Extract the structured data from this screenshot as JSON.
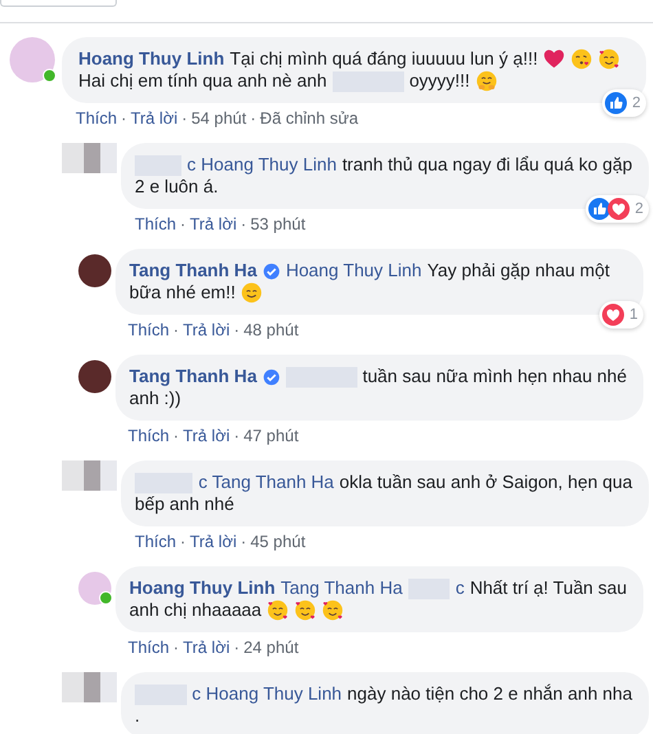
{
  "comments": [
    {
      "reply": false,
      "avatar": {
        "kind": "photo",
        "color": "#e6c8e8"
      },
      "online": true,
      "lines": [
        [
          {
            "kind": "author",
            "value": "Hoang Thuy Linh"
          },
          {
            "kind": "text",
            "value": "Tại chị mình quá đáng iuuuuu lun ý ạ!!!"
          },
          {
            "kind": "heart"
          },
          {
            "kind": "kiss"
          },
          {
            "kind": "love"
          }
        ],
        [
          {
            "kind": "text",
            "value": "Hai chị em tính qua anh nè anh"
          },
          {
            "kind": "redacted"
          },
          {
            "kind": "text",
            "value": "oyyyy!!!"
          },
          {
            "kind": "hug"
          }
        ]
      ],
      "reactions": {
        "icons": [
          {
            "kind": "like"
          }
        ],
        "count": "2"
      },
      "meta": [
        {
          "kind": "action",
          "value": "Thích"
        },
        {
          "kind": "separator",
          "value": "·"
        },
        {
          "kind": "action",
          "value": "Trả lời"
        },
        {
          "kind": "separator",
          "value": "·"
        },
        {
          "kind": "time",
          "value": "54 phút"
        },
        {
          "kind": "separator",
          "value": "·"
        },
        {
          "kind": "edited",
          "value": "Đã chỉnh sửa"
        }
      ]
    },
    {
      "reply": true,
      "avatar": {
        "kind": "blurred"
      },
      "lines": [
        [
          {
            "kind": "redacted"
          },
          {
            "kind": "mention",
            "value": "c Hoang Thuy Linh"
          },
          {
            "kind": "text",
            "value": "tranh thủ qua ngay đi lẩu quá ko gặp"
          }
        ],
        [
          {
            "kind": "text",
            "value": "2 e luôn á."
          }
        ]
      ],
      "reactions": {
        "icons": [
          {
            "kind": "like"
          },
          {
            "kind": "love"
          }
        ],
        "count": "2"
      },
      "meta": [
        {
          "kind": "action",
          "value": "Thích"
        },
        {
          "kind": "separator",
          "value": "·"
        },
        {
          "kind": "action",
          "value": "Trả lời"
        },
        {
          "kind": "separator",
          "value": "·"
        },
        {
          "kind": "time",
          "value": "53 phút"
        }
      ]
    },
    {
      "reply": true,
      "avatar": {
        "kind": "photo",
        "color": "#5a2a2a"
      },
      "verified": true,
      "lines": [
        [
          {
            "kind": "author",
            "value": "Tang Thanh Ha"
          },
          {
            "kind": "verified"
          },
          {
            "kind": "mention",
            "value": "Hoang Thuy Linh"
          },
          {
            "kind": "text",
            "value": "Yay phải gặp nhau một"
          }
        ],
        [
          {
            "kind": "text",
            "value": "bữa nhé em!!"
          },
          {
            "kind": "smile"
          }
        ]
      ],
      "reactions": {
        "icons": [
          {
            "kind": "love"
          }
        ],
        "count": "1"
      },
      "meta": [
        {
          "kind": "action",
          "value": "Thích"
        },
        {
          "kind": "separator",
          "value": "·"
        },
        {
          "kind": "action",
          "value": "Trả lời"
        },
        {
          "kind": "separator",
          "value": "·"
        },
        {
          "kind": "time",
          "value": "48 phút"
        }
      ]
    },
    {
      "reply": true,
      "avatar": {
        "kind": "photo",
        "color": "#5a2a2a"
      },
      "verified": true,
      "lines": [
        [
          {
            "kind": "author",
            "value": "Tang Thanh Ha"
          },
          {
            "kind": "verified"
          },
          {
            "kind": "redacted"
          },
          {
            "kind": "text",
            "value": "tuần sau nữa mình hẹn nhau nhé"
          }
        ],
        [
          {
            "kind": "text",
            "value": "anh :))"
          }
        ]
      ],
      "meta": [
        {
          "kind": "action",
          "value": "Thích"
        },
        {
          "kind": "separator",
          "value": "·"
        },
        {
          "kind": "action",
          "value": "Trả lời"
        },
        {
          "kind": "separator",
          "value": "·"
        },
        {
          "kind": "time",
          "value": "47 phút"
        }
      ]
    },
    {
      "reply": true,
      "avatar": {
        "kind": "blurred"
      },
      "lines": [
        [
          {
            "kind": "redacted"
          },
          {
            "kind": "mention",
            "value": "c Tang Thanh Ha"
          },
          {
            "kind": "text",
            "value": "okla tuần sau anh ở Saigon, hẹn qua"
          }
        ],
        [
          {
            "kind": "text",
            "value": "bếp anh nhé"
          }
        ]
      ],
      "meta": [
        {
          "kind": "action",
          "value": "Thích"
        },
        {
          "kind": "separator",
          "value": "·"
        },
        {
          "kind": "action",
          "value": "Trả lời"
        },
        {
          "kind": "separator",
          "value": "·"
        },
        {
          "kind": "time",
          "value": "45 phút"
        }
      ]
    },
    {
      "reply": true,
      "avatar": {
        "kind": "photo",
        "color": "#e6c8e8"
      },
      "online": true,
      "lines": [
        [
          {
            "kind": "author",
            "value": "Hoang Thuy Linh"
          },
          {
            "kind": "mention",
            "value": "Tang Thanh Ha"
          },
          {
            "kind": "redacted"
          },
          {
            "kind": "mention",
            "value": "c"
          },
          {
            "kind": "text",
            "value": "Nhất trí ạ! Tuần sau"
          }
        ],
        [
          {
            "kind": "text",
            "value": "anh chị nhaaaaa"
          },
          {
            "kind": "love"
          },
          {
            "kind": "love"
          },
          {
            "kind": "love"
          }
        ]
      ],
      "meta": [
        {
          "kind": "action",
          "value": "Thích"
        },
        {
          "kind": "separator",
          "value": "·"
        },
        {
          "kind": "action",
          "value": "Trả lời"
        },
        {
          "kind": "separator",
          "value": "·"
        },
        {
          "kind": "time",
          "value": "24 phút"
        }
      ]
    },
    {
      "reply": true,
      "avatar": {
        "kind": "blurred"
      },
      "lines": [
        [
          {
            "kind": "redacted"
          },
          {
            "kind": "mention",
            "value": "c Hoang Thuy Linh"
          },
          {
            "kind": "text",
            "value": "ngày nào tiện cho 2 e nhắn anh nha"
          }
        ],
        [
          {
            "kind": "text",
            "value": "."
          }
        ]
      ]
    }
  ]
}
